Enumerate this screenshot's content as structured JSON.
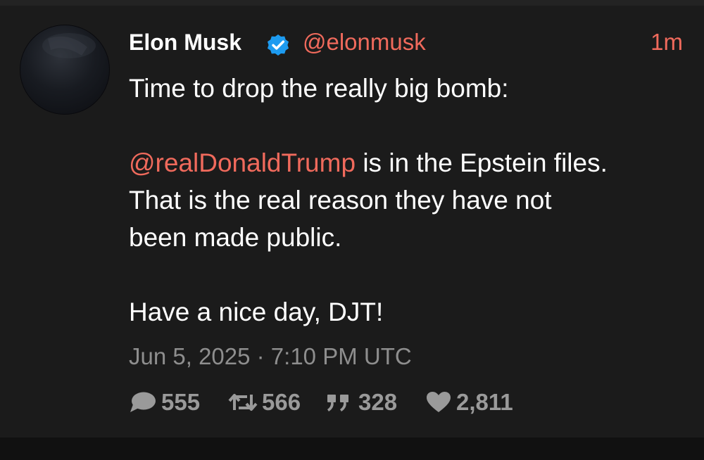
{
  "tweet": {
    "author_name": "Elon Musk",
    "handle": "@elonmusk",
    "time_ago": "1m",
    "line1": "Time to drop the really big bomb:",
    "mention": "@realDonaldTrump",
    "line2_rest": " is in the Epstein files.",
    "line3": "That is the real reason they have not",
    "line4": "been made public.",
    "line5": "Have a nice day, DJT!",
    "timestamp": "Jun 5, 2025 · 7:10 PM UTC"
  },
  "stats": {
    "replies": "555",
    "retweets": "566",
    "quotes": "328",
    "likes": "2,811"
  },
  "icons": {
    "verified": "verified-badge-icon",
    "reply": "speech-bubble-icon",
    "retweet": "retweet-icon",
    "quote": "quote-icon",
    "like": "heart-icon"
  },
  "colors": {
    "background": "#1b1b1b",
    "accent": "#f06a5c",
    "verified": "#1d9bf0",
    "muted": "#8e8e8e"
  }
}
